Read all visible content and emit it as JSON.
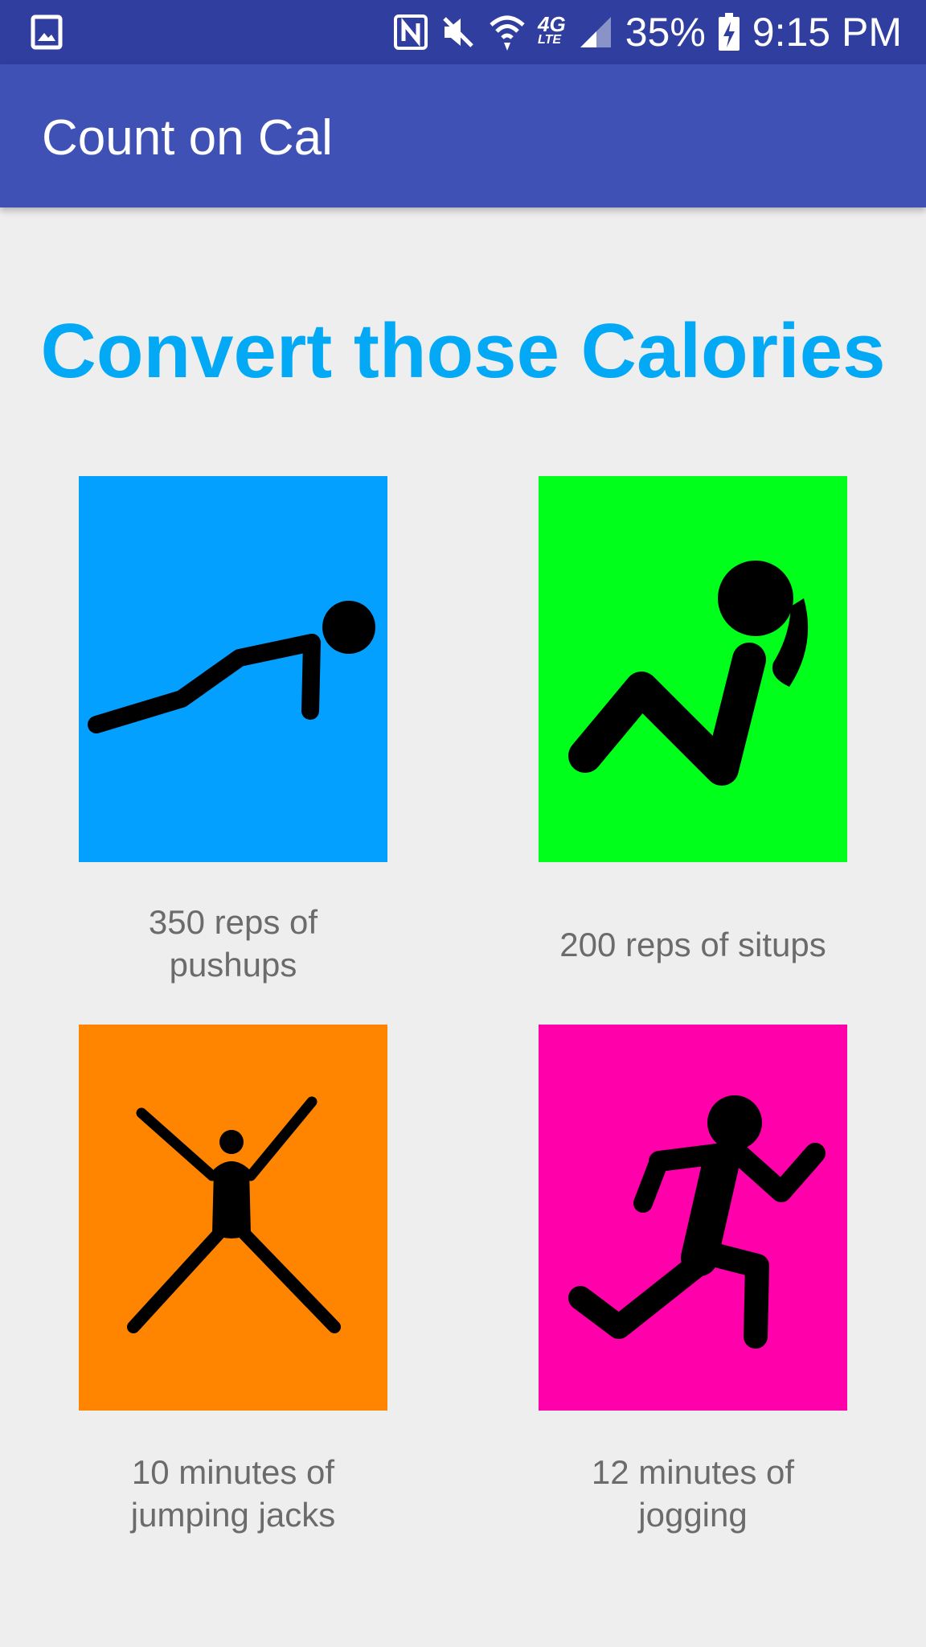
{
  "status_bar": {
    "battery": "35%",
    "time": "9:15 PM",
    "network": "4G",
    "network_sub": "LTE",
    "icons": [
      "gallery-icon",
      "nfc-icon",
      "mute-icon",
      "wifi-icon",
      "lte-icon",
      "signal-icon",
      "battery-charging-icon"
    ]
  },
  "app_bar": {
    "title": "Count on Cal"
  },
  "main": {
    "headline": "Convert those Calories",
    "activities": [
      {
        "caption_line1": "350 reps of",
        "caption_line2": "pushups",
        "color": "#03a0ff",
        "icon": "pushup-icon"
      },
      {
        "caption_line1": "200 reps of situps",
        "caption_line2": "",
        "color": "#00ff1a",
        "icon": "situp-icon"
      },
      {
        "caption_line1": "10 minutes of",
        "caption_line2": "jumping jacks",
        "color": "#ff8400",
        "icon": "jumping-jacks-icon"
      },
      {
        "caption_line1": "12 minutes of",
        "caption_line2": "jogging",
        "color": "#ff00aa",
        "icon": "jogging-icon"
      }
    ]
  },
  "colors": {
    "status_bar": "#303f9f",
    "app_bar": "#3f51b5",
    "headline": "#03a9f4",
    "background": "#eeeeee"
  }
}
